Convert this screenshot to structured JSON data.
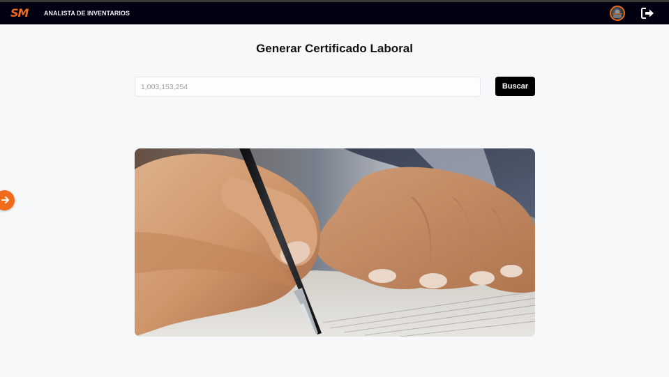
{
  "navbar": {
    "logo_text": "SM",
    "role_label": "ANALISTA DE INVENTARIOS",
    "avatar_icon": "user-avatar",
    "logout_icon": "logout-icon"
  },
  "page": {
    "title": "Generar Certificado Laboral"
  },
  "search": {
    "value": "",
    "placeholder": "1,003,153,254",
    "button_label": "Buscar"
  },
  "sidebar_toggle": {
    "icon": "arrow-right-icon"
  },
  "hero_image": {
    "subject": "hand-signing-document"
  },
  "colors": {
    "navbar_bg": "#000010",
    "accent": "#f26b1d",
    "button_bg": "#000000",
    "page_bg": "#f7f8fa"
  }
}
